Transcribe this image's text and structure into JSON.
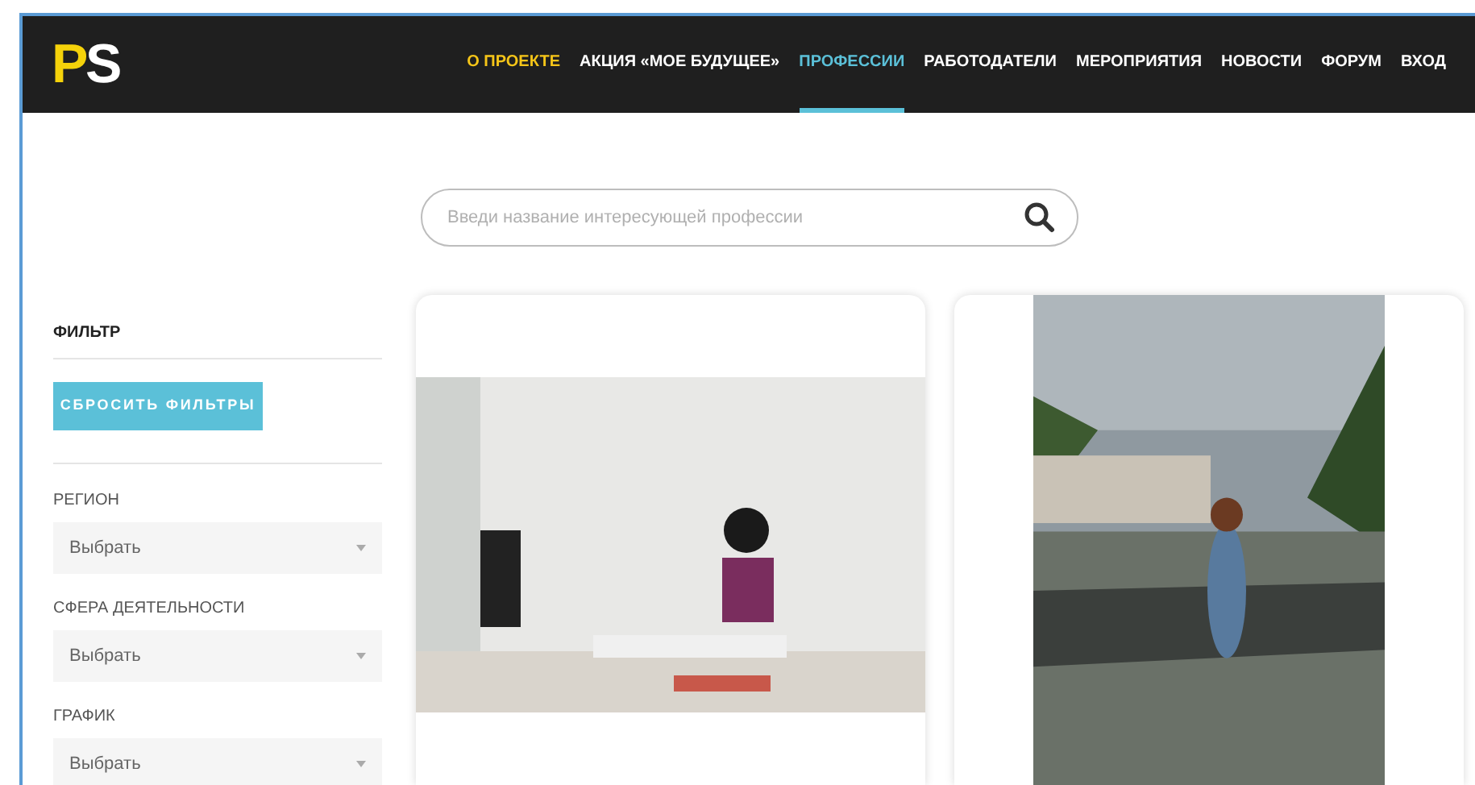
{
  "header": {
    "logo": "PS",
    "nav": [
      {
        "label": "О ПРОЕКТЕ",
        "selected": false,
        "highlighted": true
      },
      {
        "label": "АКЦИЯ «МОЕ БУДУЩЕЕ»",
        "selected": false,
        "highlighted": false
      },
      {
        "label": "ПРОФЕССИИ",
        "selected": true,
        "highlighted": false
      },
      {
        "label": "РАБОТОДАТЕЛИ",
        "selected": false,
        "highlighted": false
      },
      {
        "label": "МЕРОПРИЯТИЯ",
        "selected": false,
        "highlighted": false
      },
      {
        "label": "НОВОСТИ",
        "selected": false,
        "highlighted": false
      },
      {
        "label": "ФОРУМ",
        "selected": false,
        "highlighted": false
      },
      {
        "label": "ВХОД",
        "selected": false,
        "highlighted": false
      }
    ]
  },
  "search": {
    "placeholder": "Введи название интересующей профессии"
  },
  "filter": {
    "title": "ФИЛЬТР",
    "reset_button": "СБРОСИТЬ ФИЛЬТРЫ",
    "fields": [
      {
        "label": "РЕГИОН",
        "value": "Выбрать"
      },
      {
        "label": "СФЕРА ДЕЯТЕЛЬНОСТИ",
        "value": "Выбрать"
      },
      {
        "label": "ГРАФИК",
        "value": "Выбрать"
      }
    ]
  },
  "cards": [
    {
      "kind": "office"
    },
    {
      "kind": "river"
    }
  ]
}
